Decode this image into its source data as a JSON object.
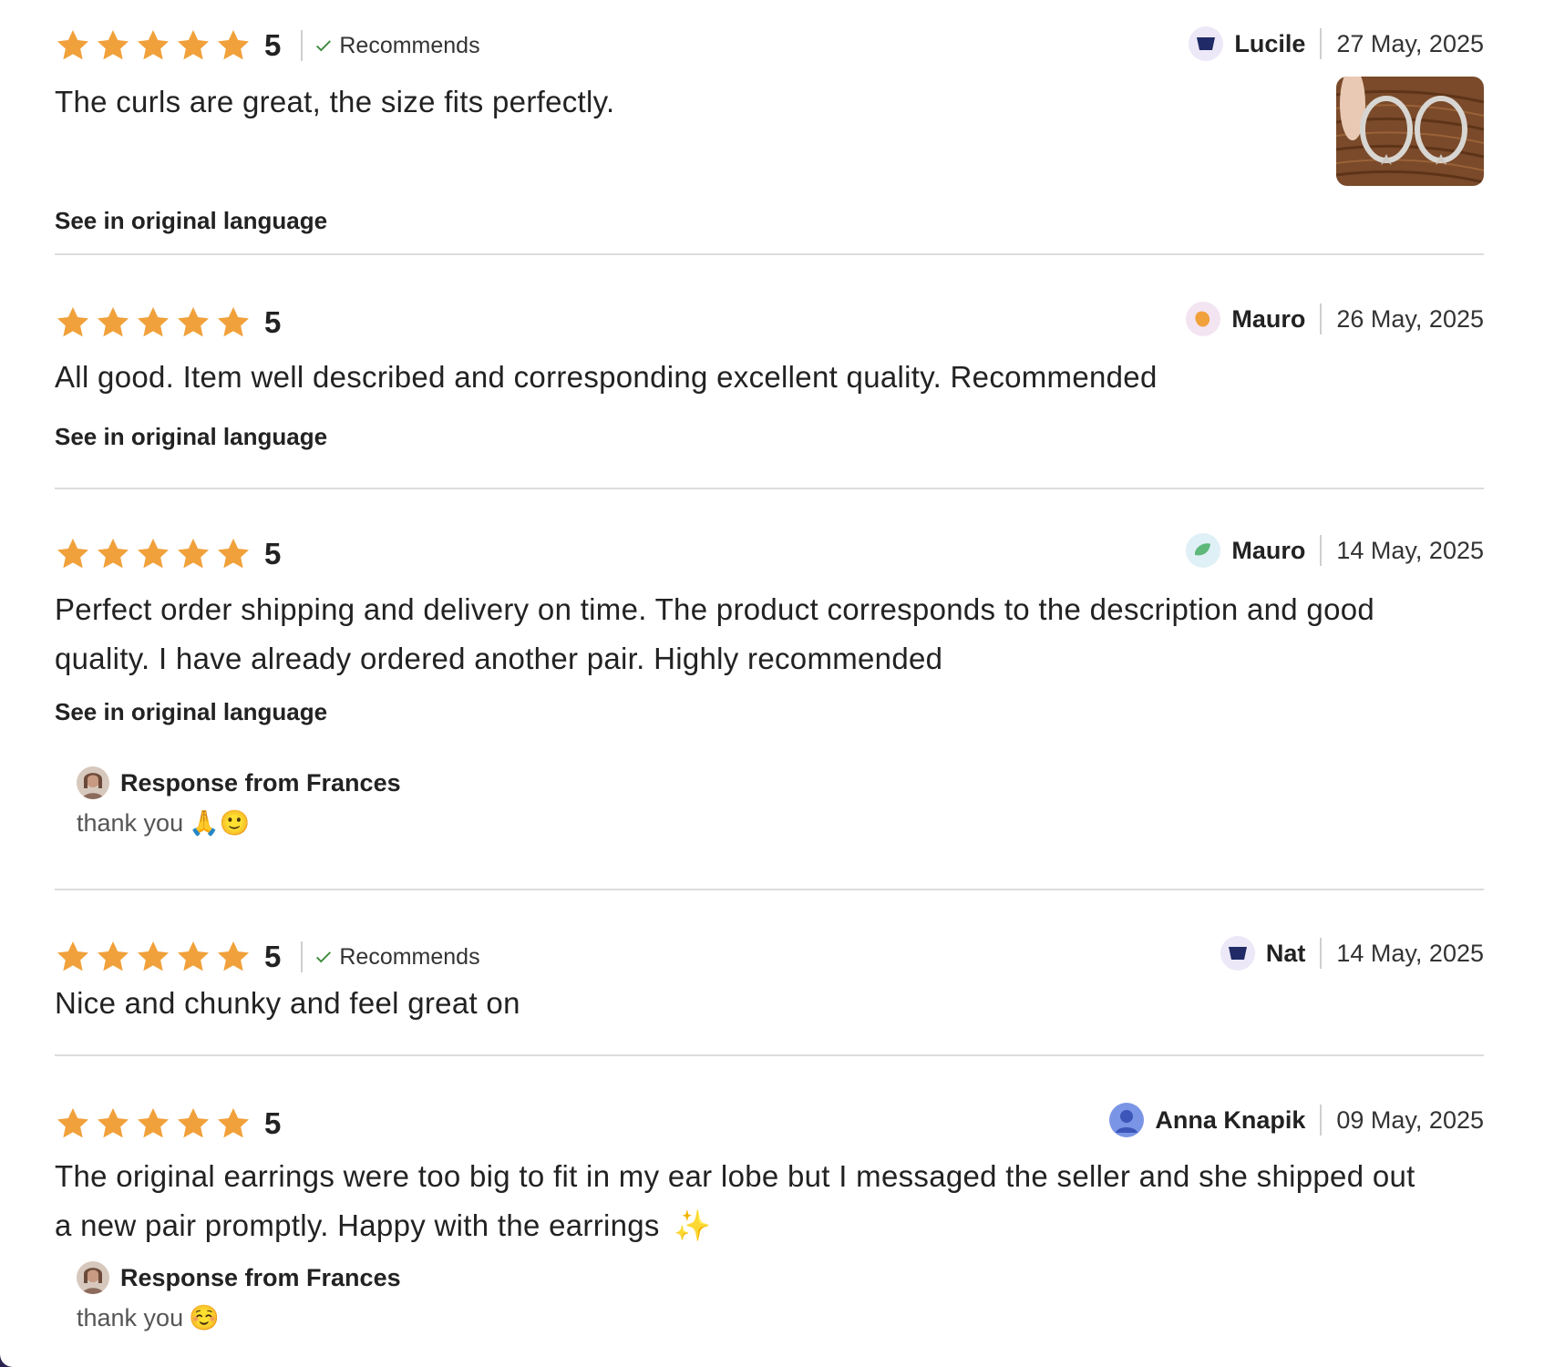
{
  "colors": {
    "star": "#F1A13B",
    "divider": "#dcdcdc",
    "text": "#222222",
    "check": "#3a8a3a"
  },
  "reviews": [
    {
      "rating": 5,
      "score_label": "5",
      "recommends": true,
      "recommends_label": "Recommends",
      "author": "Lucile",
      "avatar_icon": "navy-shape-icon",
      "date": "27 May, 2025",
      "text": "The curls are great, the size fits perfectly.",
      "see_original": "See in original language",
      "has_photo": true
    },
    {
      "rating": 5,
      "score_label": "5",
      "recommends": false,
      "author": "Mauro",
      "avatar_icon": "orange-blob-icon",
      "date": "26 May, 2025",
      "text": "All good. Item well described and corresponding excellent quality. Recommended",
      "see_original": "See in original language"
    },
    {
      "rating": 5,
      "score_label": "5",
      "recommends": false,
      "author": "Mauro",
      "avatar_icon": "green-leaf-icon",
      "date": "14 May, 2025",
      "text_line1": "Perfect order shipping and delivery on time. The product corresponds to the description and good",
      "text_line2": "quality. I have already ordered another pair. Highly recommended",
      "see_original": "See in original language",
      "response": {
        "title": "Response from Frances",
        "text": "thank you",
        "emoji": "🙏🙂"
      }
    },
    {
      "rating": 5,
      "score_label": "5",
      "recommends": true,
      "recommends_label": "Recommends",
      "author": "Nat",
      "avatar_icon": "navy-shape-icon",
      "date": "14 May, 2025",
      "text": "Nice and chunky and feel great on"
    },
    {
      "rating": 5,
      "score_label": "5",
      "recommends": false,
      "author": "Anna Knapik",
      "avatar_icon": "user-silhouette-icon",
      "date": "09 May, 2025",
      "text_line1": "The original earrings were too big to fit in my ear lobe but I messaged the seller and she shipped out",
      "text_line2": "a new pair promptly. Happy with the earrings",
      "text_emoji": "✨",
      "response": {
        "title": "Response from Frances",
        "text": "thank you",
        "emoji": "☺️"
      }
    }
  ]
}
